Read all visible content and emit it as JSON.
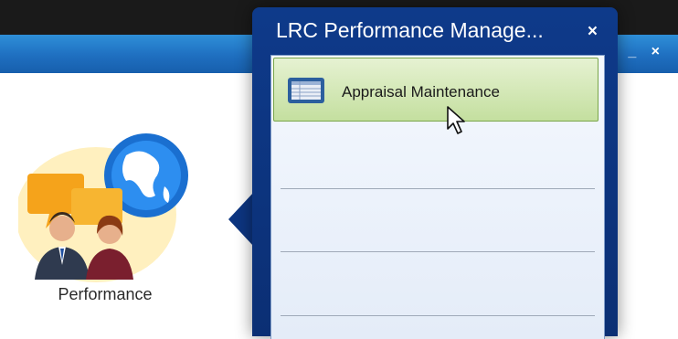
{
  "background_window": {
    "controls": "_ ×"
  },
  "desktop_icon": {
    "label": "Performance",
    "icon": "performance-icon"
  },
  "popup": {
    "title": "LRC Performance Manage...",
    "close": "×",
    "items": [
      {
        "label": "Appraisal Maintenance",
        "icon": "table-icon"
      }
    ]
  },
  "colors": {
    "titlebar": "#1f6fc0",
    "popup_bg": "#0e3a8a",
    "selected_item": "#c4df9f"
  }
}
